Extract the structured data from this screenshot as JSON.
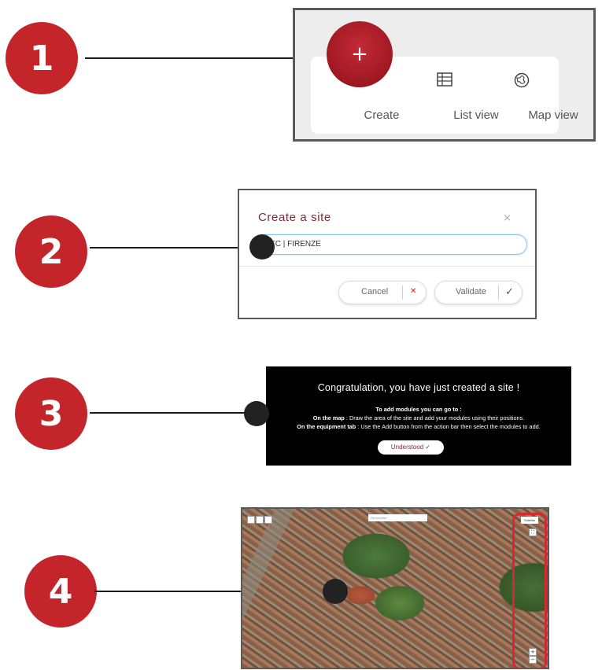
{
  "steps": [
    "1",
    "2",
    "3",
    "4"
  ],
  "panel1": {
    "plus_label": "+",
    "create_label": "Create",
    "list_view_label": "List view",
    "map_view_label": "Map view"
  },
  "panel2": {
    "title": "Create a site",
    "close_label": "×",
    "field_value": "ETC | FIRENZE",
    "cancel_label": "Cancel",
    "cancel_mark": "✕",
    "validate_label": "Validate",
    "validate_mark": "✓",
    "colors": {
      "title": "#7b2b33",
      "cancel_mark": "#c4252b"
    }
  },
  "panel3": {
    "heading": "Congratulation, you have just created a site !",
    "line1": "To add modules you can go to :",
    "line2_bold": "On the map",
    "line2_rest": " : Draw the area of the site and add your modules using their positions.",
    "line3_bold": "On the equipment tab",
    "line3_rest": " : Use the Add button from the action bar then select the modules to add.",
    "button_label": "Understood ✓"
  },
  "panel4": {
    "search_placeholder": "Rechercher",
    "map_type_label": "Satellite",
    "zoom_in": "+",
    "zoom_out": "−",
    "fullscreen": "⛶",
    "highlight_color": "#d42a2f"
  },
  "colors": {
    "step": "#c4252b",
    "accent": "#9e1822"
  }
}
